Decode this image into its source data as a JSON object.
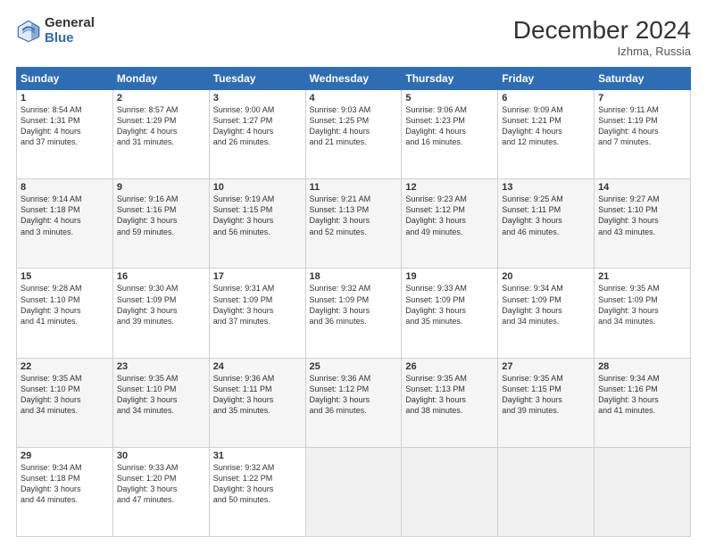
{
  "header": {
    "logo_general": "General",
    "logo_blue": "Blue",
    "month_title": "December 2024",
    "location": "Izhma, Russia"
  },
  "weekdays": [
    "Sunday",
    "Monday",
    "Tuesday",
    "Wednesday",
    "Thursday",
    "Friday",
    "Saturday"
  ],
  "weeks": [
    [
      {
        "day": "1",
        "info": "Sunrise: 8:54 AM\nSunset: 1:31 PM\nDaylight: 4 hours\nand 37 minutes."
      },
      {
        "day": "2",
        "info": "Sunrise: 8:57 AM\nSunset: 1:29 PM\nDaylight: 4 hours\nand 31 minutes."
      },
      {
        "day": "3",
        "info": "Sunrise: 9:00 AM\nSunset: 1:27 PM\nDaylight: 4 hours\nand 26 minutes."
      },
      {
        "day": "4",
        "info": "Sunrise: 9:03 AM\nSunset: 1:25 PM\nDaylight: 4 hours\nand 21 minutes."
      },
      {
        "day": "5",
        "info": "Sunrise: 9:06 AM\nSunset: 1:23 PM\nDaylight: 4 hours\nand 16 minutes."
      },
      {
        "day": "6",
        "info": "Sunrise: 9:09 AM\nSunset: 1:21 PM\nDaylight: 4 hours\nand 12 minutes."
      },
      {
        "day": "7",
        "info": "Sunrise: 9:11 AM\nSunset: 1:19 PM\nDaylight: 4 hours\nand 7 minutes."
      }
    ],
    [
      {
        "day": "8",
        "info": "Sunrise: 9:14 AM\nSunset: 1:18 PM\nDaylight: 4 hours\nand 3 minutes."
      },
      {
        "day": "9",
        "info": "Sunrise: 9:16 AM\nSunset: 1:16 PM\nDaylight: 3 hours\nand 59 minutes."
      },
      {
        "day": "10",
        "info": "Sunrise: 9:19 AM\nSunset: 1:15 PM\nDaylight: 3 hours\nand 56 minutes."
      },
      {
        "day": "11",
        "info": "Sunrise: 9:21 AM\nSunset: 1:13 PM\nDaylight: 3 hours\nand 52 minutes."
      },
      {
        "day": "12",
        "info": "Sunrise: 9:23 AM\nSunset: 1:12 PM\nDaylight: 3 hours\nand 49 minutes."
      },
      {
        "day": "13",
        "info": "Sunrise: 9:25 AM\nSunset: 1:11 PM\nDaylight: 3 hours\nand 46 minutes."
      },
      {
        "day": "14",
        "info": "Sunrise: 9:27 AM\nSunset: 1:10 PM\nDaylight: 3 hours\nand 43 minutes."
      }
    ],
    [
      {
        "day": "15",
        "info": "Sunrise: 9:28 AM\nSunset: 1:10 PM\nDaylight: 3 hours\nand 41 minutes."
      },
      {
        "day": "16",
        "info": "Sunrise: 9:30 AM\nSunset: 1:09 PM\nDaylight: 3 hours\nand 39 minutes."
      },
      {
        "day": "17",
        "info": "Sunrise: 9:31 AM\nSunset: 1:09 PM\nDaylight: 3 hours\nand 37 minutes."
      },
      {
        "day": "18",
        "info": "Sunrise: 9:32 AM\nSunset: 1:09 PM\nDaylight: 3 hours\nand 36 minutes."
      },
      {
        "day": "19",
        "info": "Sunrise: 9:33 AM\nSunset: 1:09 PM\nDaylight: 3 hours\nand 35 minutes."
      },
      {
        "day": "20",
        "info": "Sunrise: 9:34 AM\nSunset: 1:09 PM\nDaylight: 3 hours\nand 34 minutes."
      },
      {
        "day": "21",
        "info": "Sunrise: 9:35 AM\nSunset: 1:09 PM\nDaylight: 3 hours\nand 34 minutes."
      }
    ],
    [
      {
        "day": "22",
        "info": "Sunrise: 9:35 AM\nSunset: 1:10 PM\nDaylight: 3 hours\nand 34 minutes."
      },
      {
        "day": "23",
        "info": "Sunrise: 9:35 AM\nSunset: 1:10 PM\nDaylight: 3 hours\nand 34 minutes."
      },
      {
        "day": "24",
        "info": "Sunrise: 9:36 AM\nSunset: 1:11 PM\nDaylight: 3 hours\nand 35 minutes."
      },
      {
        "day": "25",
        "info": "Sunrise: 9:36 AM\nSunset: 1:12 PM\nDaylight: 3 hours\nand 36 minutes."
      },
      {
        "day": "26",
        "info": "Sunrise: 9:35 AM\nSunset: 1:13 PM\nDaylight: 3 hours\nand 38 minutes."
      },
      {
        "day": "27",
        "info": "Sunrise: 9:35 AM\nSunset: 1:15 PM\nDaylight: 3 hours\nand 39 minutes."
      },
      {
        "day": "28",
        "info": "Sunrise: 9:34 AM\nSunset: 1:16 PM\nDaylight: 3 hours\nand 41 minutes."
      }
    ],
    [
      {
        "day": "29",
        "info": "Sunrise: 9:34 AM\nSunset: 1:18 PM\nDaylight: 3 hours\nand 44 minutes."
      },
      {
        "day": "30",
        "info": "Sunrise: 9:33 AM\nSunset: 1:20 PM\nDaylight: 3 hours\nand 47 minutes."
      },
      {
        "day": "31",
        "info": "Sunrise: 9:32 AM\nSunset: 1:22 PM\nDaylight: 3 hours\nand 50 minutes."
      },
      null,
      null,
      null,
      null
    ]
  ]
}
